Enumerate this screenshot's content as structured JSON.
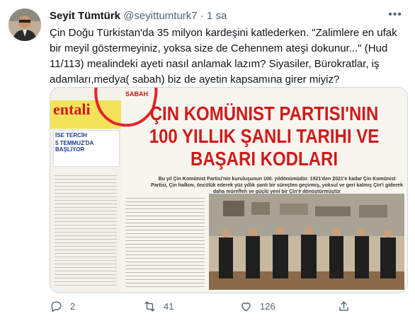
{
  "author": {
    "name": "Seyit Tümtürk",
    "handle": "@seyittumturk7",
    "separator": "·",
    "time": "1 sa"
  },
  "tweet": {
    "text": "Çin Doğu Türkistan'da  35 milyon kardeşini katlederken. \"Zalimlere en ufak bir meyil göstermeyiniz, yoksa size de Cehennem ateşi dokunur...\" (Hud 11/113) mealindeki ayeti nasıl anlamak lazım? Siyasiler, Bürokratlar, iş adamları,medya( sabah) biz de ayetin kapsamına girer miyiz?"
  },
  "media": {
    "headline": [
      "ÇIN KOMÜNIST PARTISI'NIN",
      "100 YILLIK ŞANLI TARIHI VE",
      "BAŞARI KODLARI"
    ],
    "subtext": "Bu yıl Çin Komünist Partisi'nin kuruluşunun 100. yıldönümüdür. 1921'den 2021'e kadar Çin Komünist Partisi, Çin halkını, öncülük ederek yüz yıllık şanlı bir süreçten geçirmiş, yoksul ve geri kalmış Çin'i giderek daha müreffeh ve güçlü yeni bir Çin'e dönüştürmüştür",
    "logo": "SABAH",
    "side_text": [
      "entali",
      "İSE TERCİH",
      "5 TEMMUZ'DA",
      "BAŞLIYOR"
    ]
  },
  "actions": {
    "replies": "2",
    "retweets": "41",
    "likes": "126"
  },
  "colors": {
    "accent": "#1d9bf0",
    "muted": "#536471",
    "headline_red": "#d11a1a"
  }
}
